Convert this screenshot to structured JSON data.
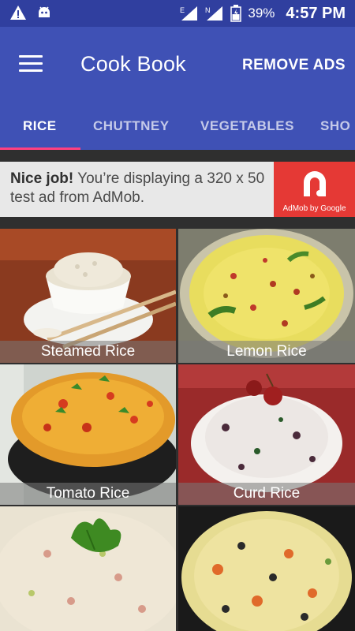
{
  "status_bar": {
    "battery": "39%",
    "time": "4:57 PM",
    "icons": [
      "warning-icon",
      "android-icon",
      "signal-e-icon",
      "signal-n-icon",
      "battery-icon"
    ]
  },
  "app_bar": {
    "title": "Cook Book",
    "action": "REMOVE ADS"
  },
  "tabs": [
    {
      "label": "RICE",
      "active": true
    },
    {
      "label": "CHUTTNEY",
      "active": false
    },
    {
      "label": "VEGETABLES",
      "active": false
    },
    {
      "label": "SHO",
      "active": false
    }
  ],
  "ad": {
    "bold": "Nice job!",
    "text": "You’re displaying a 320 x 50 test ad from AdMob.",
    "logo_caption": "AdMob by Google",
    "logo_color": "#e53935"
  },
  "recipes": [
    {
      "name": "Steamed Rice"
    },
    {
      "name": "Lemon Rice"
    },
    {
      "name": "Tomato Rice"
    },
    {
      "name": "Curd Rice"
    },
    {
      "name": ""
    },
    {
      "name": ""
    }
  ],
  "colors": {
    "primary": "#3f51b5",
    "primary_dark": "#303f9f",
    "accent": "#ff4081"
  }
}
